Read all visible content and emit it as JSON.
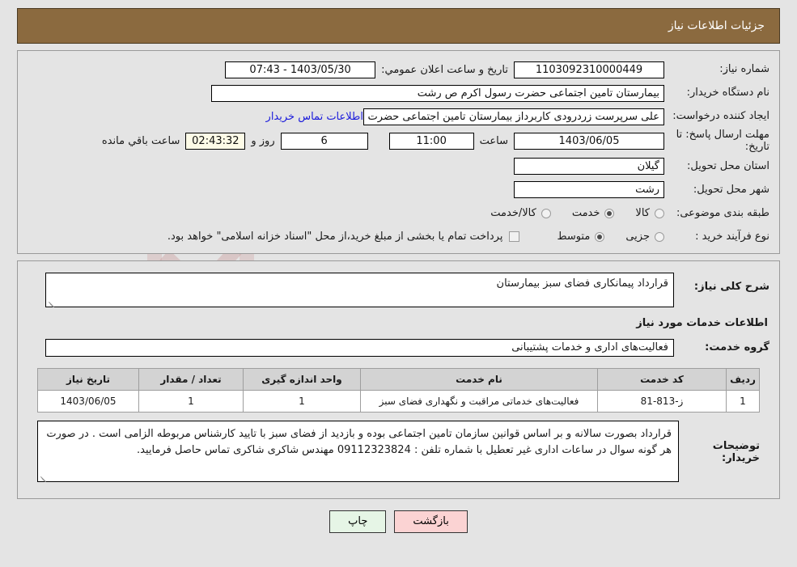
{
  "header": {
    "title": "جزئیات اطلاعات نیاز"
  },
  "top_form": {
    "need_number_label": "شماره نیاز:",
    "need_number_value": "1103092310000449",
    "public_announce_label": "تاریخ و ساعت اعلان عمومي:",
    "public_announce_value": "1403/05/30 - 07:43",
    "buyer_org_label": "نام دستگاه خریدار:",
    "buyer_org_value": "بیمارستان  تامین اجتماعی حضرت رسول اکرم ص رشت",
    "creator_label": "ایجاد کننده درخواست:",
    "creator_value": "علی سرپرست زردرودی کاربرداز بیمارستان  تامین اجتماعی حضرت رسول اکرم د",
    "contact_link": "اطلاعات تماس خریدار",
    "deadline_label": "مهلت ارسال پاسخ: تا تاریخ:",
    "deadline_value": "1403/06/05",
    "time_label": "ساعت",
    "time_value": "11:00",
    "days_value": "6",
    "days_and_label": "روز و",
    "countdown_value": "02:43:32",
    "remaining_label": "ساعت باقي مانده",
    "province_label": "استان محل تحویل:",
    "province_value": "گیلان",
    "city_label": "شهر محل تحویل:",
    "city_value": "رشت",
    "category_label": "طبقه بندی موضوعی:",
    "category_options": [
      {
        "label": "کالا",
        "selected": false
      },
      {
        "label": "خدمت",
        "selected": true
      },
      {
        "label": "کالا/خدمت",
        "selected": false
      }
    ],
    "process_label": "نوع فرآیند خرید :",
    "process_options": [
      {
        "label": "جزیی",
        "selected": false
      },
      {
        "label": "متوسط",
        "selected": true
      }
    ],
    "treasury_checkbox_label": "پرداخت تمام یا بخشی از مبلغ خرید،از محل \"اسناد خزانه اسلامی\" خواهد بود.",
    "treasury_checked": false
  },
  "middle": {
    "general_desc_label": "شرح کلی نیاز:",
    "general_desc_value": "قرارداد پیمانکاری فضای سبز بیمارستان",
    "services_info_title": "اطلاعات خدمات مورد نیاز",
    "service_group_label": "گروه خدمت:",
    "service_group_value": "فعالیت‌های اداری و خدمات پشتیبانی"
  },
  "table": {
    "headers": [
      "ردیف",
      "کد خدمت",
      "نام خدمت",
      "واحد اندازه گیری",
      "تعداد / مقدار",
      "تاریخ نیاز"
    ],
    "rows": [
      {
        "radif": "1",
        "code": "ز-813-81",
        "name": "فعالیت‌های خدماتی مراقبت و نگهداری فضای سبز",
        "unit": "1",
        "quantity": "1",
        "date": "1403/06/05"
      }
    ]
  },
  "notes": {
    "label": "توضیحات خریدار:",
    "value": "قرارداد بصورت سالانه و بر اساس قوانین سازمان تامین اجتماعی بوده و بازدید از  فضای سبز با تایید کارشناس مربوطه الزامی است . در صورت هر گونه سوال در ساعات اداری غیر تعطیل با شماره تلفن : 09112323824 مهندس  شاکری  شاکری  تماس حاصل فرمایید."
  },
  "footer": {
    "back_label": "بازگشت",
    "print_label": "چاپ"
  },
  "watermark": {
    "text": "AriaTender",
    "suffix": ".net"
  },
  "colors": {
    "header_bar": "#8b6a3f",
    "link": "#1a1adb",
    "back_button": "#fbd3d3",
    "print_button": "#e6f5e6",
    "countdown_field": "#fdfbe7",
    "page_background": "#e4e4e4"
  }
}
